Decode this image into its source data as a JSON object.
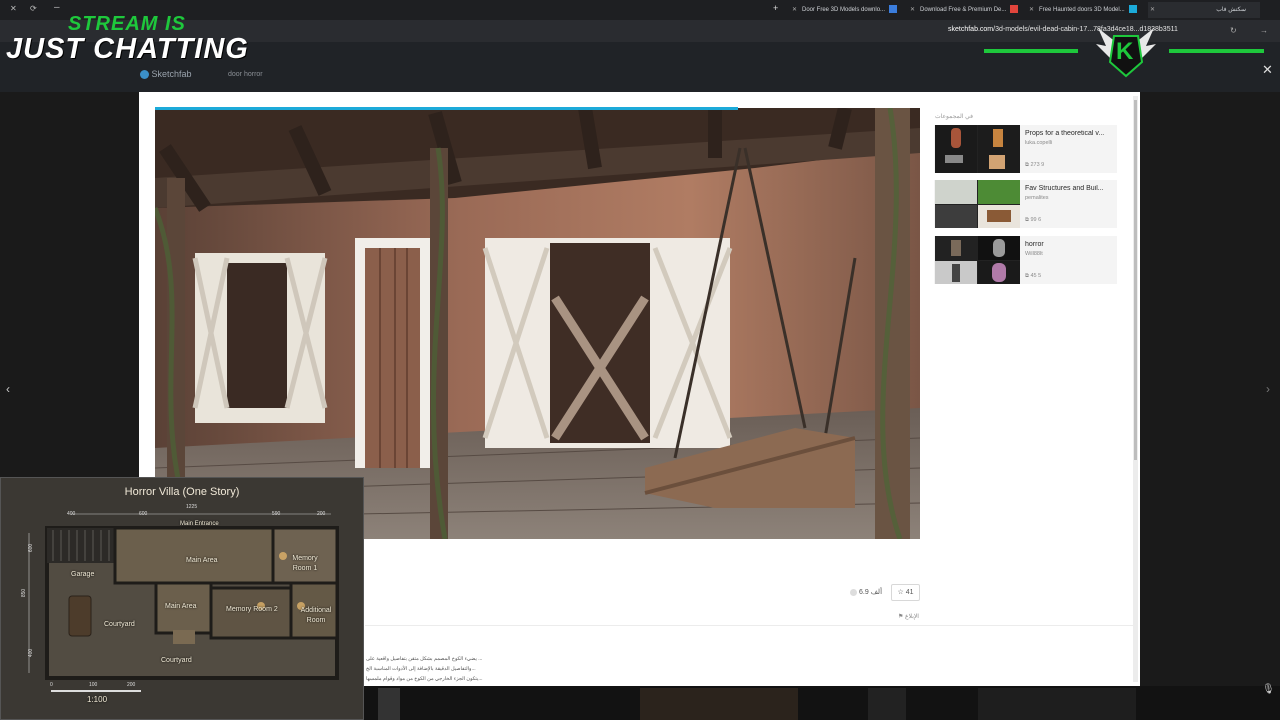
{
  "browser": {
    "tabs": [
      {
        "label": "Door Free 3D Models downlo..."
      },
      {
        "label": "Download Free & Premium De..."
      },
      {
        "label": "Free Haunted doors 3D Model..."
      },
      {
        "label": "سكتش فاب"
      }
    ],
    "url_host": "sketchfab.com",
    "url_path": "/3d-models/evil-dead-cabin-17...78fa3d4ce18...d1838b3511",
    "new_tab": "+"
  },
  "site": {
    "logo": "Sketchfab",
    "search_value": "door horror"
  },
  "overlay": {
    "stream_line1": "STREAM IS",
    "stream_line2": "JUST CHATTING",
    "logo_letter": "K"
  },
  "sidebar": {
    "title": "في المجموعات",
    "collections": [
      {
        "name": "Props for a theoretical v...",
        "owner": "luka.copelli",
        "stats": "273  9"
      },
      {
        "name": "Fav Structures and Buil...",
        "owner": "pemalites",
        "stats": "99  6"
      },
      {
        "name": "horror",
        "owner": "Will88lt",
        "stats": "45  5"
      }
    ]
  },
  "model": {
    "likes": "41",
    "views": "6.9 ألف",
    "report": "الإبلاغ",
    "description": [
      "يضيء الكوخ المصمم بشكل متقن بتفاصيل واقعية على ...",
      "والتفاصيل الدقيقة بالإضافة إلى الأدوات المناسبة الخ...",
      "يتكون الجزء الخارجي من الكوخ من مواد وقوام ملمسها..."
    ]
  },
  "map": {
    "title": "Horror Villa (One Story)",
    "rooms": {
      "main_entrance": "Main Entrance",
      "main_area_top": "Main Area",
      "memory_room_1": "Memory Room 1",
      "garage": "Garage",
      "main_area_mid": "Main Area",
      "memory_room_2": "Memory Room 2",
      "additional_room": "Additional Room",
      "courtyard_left": "Courtyard",
      "courtyard_bottom": "Courtyard"
    },
    "dims": {
      "top_total": "1225",
      "d400": "400",
      "d600": "600",
      "d590": "590",
      "d200": "200",
      "left_850": "850",
      "left_600": "600",
      "left_400": "400"
    },
    "scale_ticks": [
      "0",
      "100",
      "200"
    ],
    "scale": "1:100"
  }
}
